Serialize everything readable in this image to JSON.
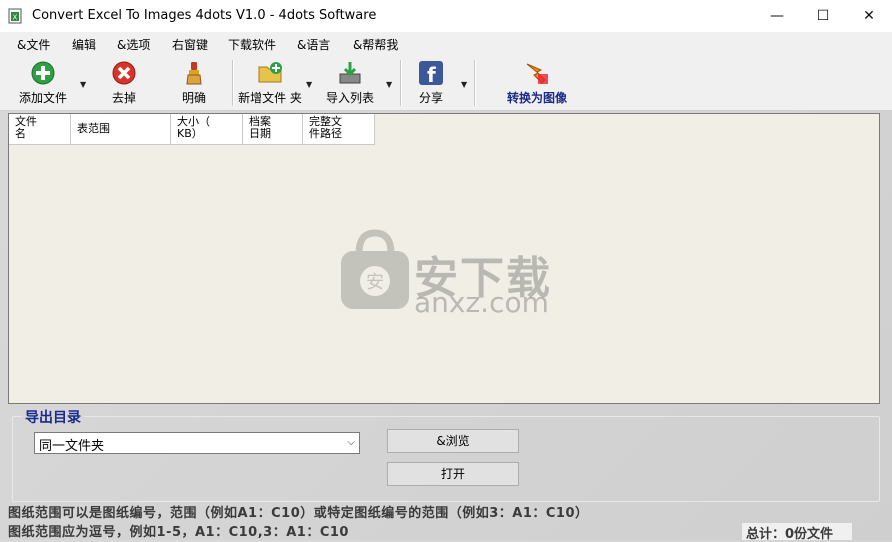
{
  "window": {
    "title": "Convert Excel To Images 4dots V1.0 - 4dots Software"
  },
  "menu": [
    "&文件",
    "编辑",
    "&选项",
    "右窗键",
    "下载软件",
    "&语言",
    "&帮帮我"
  ],
  "toolbar": {
    "add_file": "添加文件",
    "remove": "去掉",
    "clear": "明确",
    "add_folder": "新增文件 夹",
    "import_list": "导入列表",
    "share": "分享",
    "convert": "转换为图像"
  },
  "table": {
    "columns": [
      "文件名",
      "表范围",
      "大小（KB）",
      "档案日期",
      "完整文件路径"
    ],
    "column_display": [
      "文件\n名",
      "表范围",
      "大小（\nKB）",
      "档案\n日期",
      "完整文\n件路径"
    ]
  },
  "watermark": {
    "title": "安下载",
    "url": "anxz.com"
  },
  "output": {
    "legend": "导出目录",
    "folder_option": "同一文件夹",
    "browse_label": "&浏览",
    "open_label": "打开"
  },
  "hints": {
    "line1": "图纸范围可以是图纸编号，范围（例如A1：C10）或特定图纸编号的范围（例如3：A1：C10）",
    "line2": "图纸范围应为逗号，例如1-5，A1：C10,3：A1：C10"
  },
  "status": {
    "total": "总计：0份文件"
  },
  "colors": {
    "accent_blue": "#1a2a8a",
    "list_bg": "#f1efe5"
  }
}
